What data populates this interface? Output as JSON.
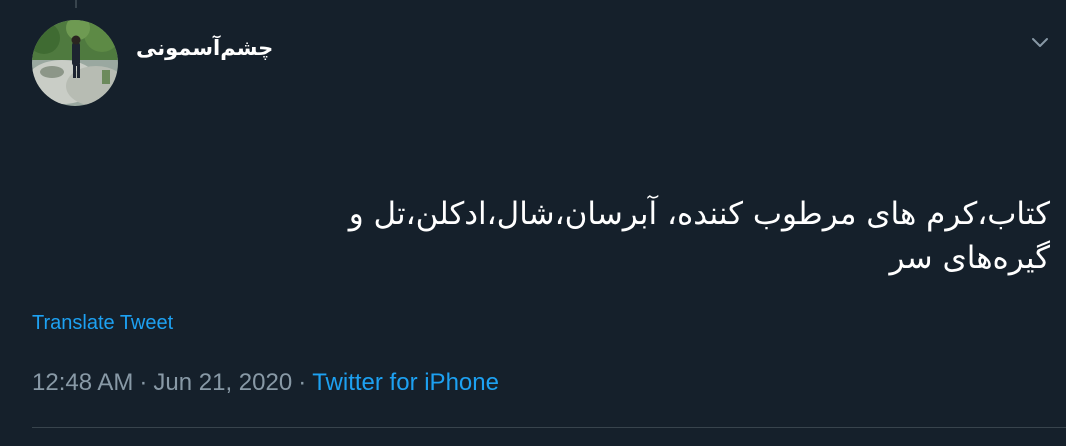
{
  "tweet": {
    "display_name": "چشم‌آسمونی",
    "text_lines": [
      "کتاب،کرم های مرطوب کننده، آبرسان،شال،ادکلن،تل و",
      "گیره‌های سر"
    ],
    "translate_label": "Translate Tweet",
    "time": "12:48 AM",
    "separator": "·",
    "date": "Jun 21, 2020",
    "source": "Twitter for iPhone"
  },
  "icons": {
    "avatar": "profile-photo",
    "menu": "chevron-down-icon"
  },
  "colors": {
    "background": "#15202b",
    "text": "#ffffff",
    "secondary_text": "#8899a6",
    "link": "#1da1f2",
    "divider": "#38444d"
  }
}
